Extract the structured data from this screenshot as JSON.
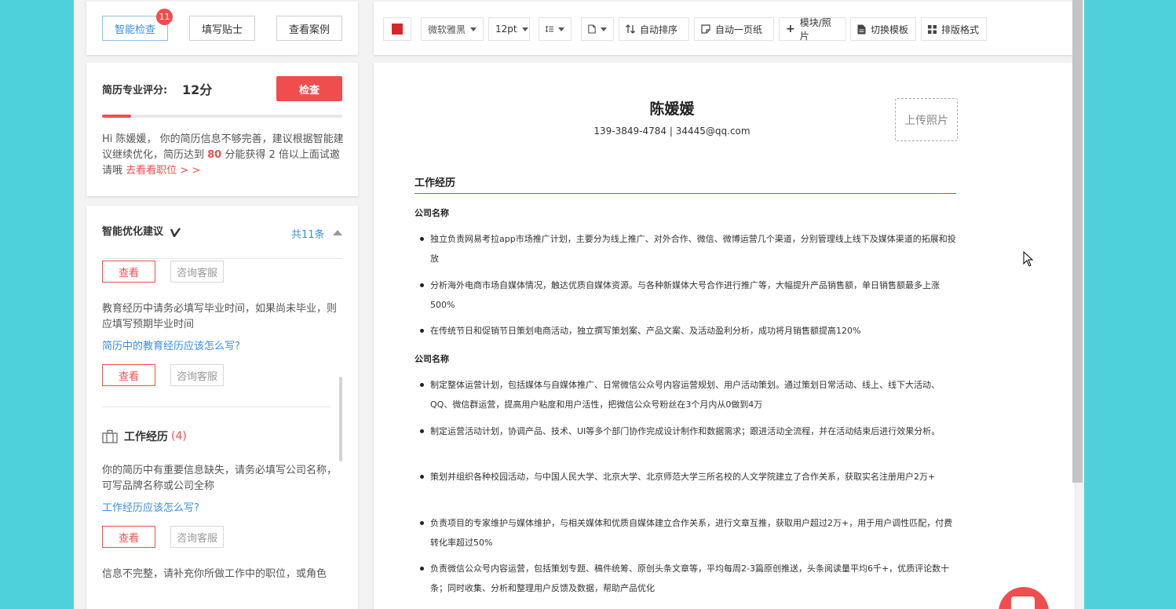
{
  "tabs": [
    {
      "label": "智能检查",
      "badge": "11",
      "active": true
    },
    {
      "label": "填写贴士",
      "active": false
    },
    {
      "label": "查看案例",
      "active": false
    }
  ],
  "score": {
    "label": "简历专业评分:",
    "value": "12分",
    "check_button": "检查",
    "progress_percent": 12,
    "msg_part1": "Hi 陈媛媛， 你的简历信息不够完善，建议根据智能建议继续优化，简历达到 ",
    "msg_highlight": "80",
    "msg_part2": " 分能获得 2 倍以上面试邀请哦 ",
    "msg_link": "去看看职位 > >"
  },
  "suggestions": {
    "title": "智能优化建议",
    "title_icon": "v-icon",
    "count": "共11条",
    "view_label": "查看",
    "consult_label": "咨询客服",
    "item1_text": "教育经历中请务必填写毕业时间，如果尚未毕业，则应填写预期毕业时间",
    "item1_link": "简历中的教育经历应该怎么写?",
    "work_section_title": "工作经历",
    "work_section_count": "(4)",
    "item2_text": "你的简历中有重要信息缺失，请务必填写公司名称，可写品牌名称或公司全称",
    "item2_link": "工作经历应该怎么写?",
    "item3_text": "信息不完整，请补充你所做工作中的职位，或角色"
  },
  "toolbar": {
    "color": "#d9262a",
    "font": "微软雅黑",
    "size": "12pt",
    "auto_sort": "自动排序",
    "one_page": "自动一页纸",
    "module_photo": "模块/照片",
    "switch_template": "切换模板",
    "layout_format": "排版格式"
  },
  "resume": {
    "name": "陈媛媛",
    "contact": "139-3849-4784 | 34445@qq.com",
    "upload_photo": "上传照片",
    "section_title": "工作经历",
    "company1": "公司名称",
    "company1_bullets": [
      "独立负责网易考拉app市场推广计划，主要分为线上推广、对外合作、微信、微博运营几个渠道，分别管理线上线下及媒体渠道的拓展和投放",
      "分析海外电商市场自媒体情况，触达优质自媒体资源。与各种新媒体大号合作进行推广等，大幅提升产品销售额，单日销售额最多上涨500%",
      "在传统节日和促销节日策划电商活动，独立撰写策划案、产品文案、及活动盈利分析，成功将月销售额提高120%"
    ],
    "company2": "公司名称",
    "company2_bullets": [
      "制定整体运营计划，包括媒体与自媒体推广、日常微信公众号内容运营规划、用户活动策划。通过策划日常活动、线上、线下大活动、QQ、微信群运营，提高用户粘度和用户活性，把微信公众号粉丝在3个月内从0做到4万",
      "制定运营活动计划，协调产品、技术、UI等多个部门协作完成设计制作和数据需求；跟进活动全流程，并在活动结束后进行效果分析。",
      "策划并组织各种校园活动，与中国人民大学、北京大学、北京师范大学三所名校的人文学院建立了合作关系，获取实名注册用户2万+",
      "负责项目的专家维护与媒体维护，与相关媒体和优质自媒体建立合作关系，进行文章互推，获取用户超过2万+，用于用户调性匹配，付费转化率超过50%",
      "负责微信公众号内容运营，包括策划专题、稿件统筹、原创头条文章等，平均每周2-3篇原创推送，头条阅读量平均6千+，优质评论数十条；同时收集、分析和整理用户反馈及数据，帮助产品优化"
    ]
  }
}
